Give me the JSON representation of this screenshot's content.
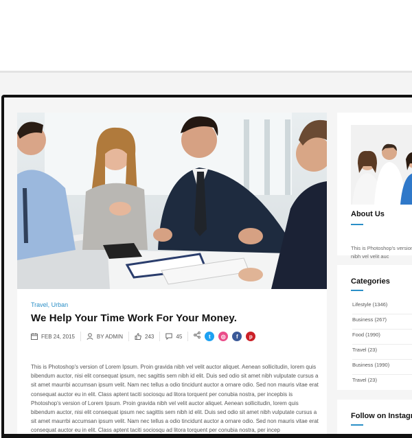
{
  "post": {
    "categories": "Travel, Urban",
    "title": "We Help Your Time Work For Your Money.",
    "meta": {
      "date": "FEB 24, 2015",
      "author": "BY ADMIN",
      "likes": "243",
      "comments": "45"
    },
    "social": [
      {
        "name": "twitter",
        "glyph": "t",
        "color": "#1da1f2"
      },
      {
        "name": "dribbble",
        "glyph": "◎",
        "color": "#ea4c89"
      },
      {
        "name": "facebook",
        "glyph": "f",
        "color": "#3b5998"
      },
      {
        "name": "pinterest",
        "glyph": "p",
        "color": "#cb2027"
      }
    ],
    "body": "This is Photoshop's version  of Lorem Ipsum. Proin gravida nibh vel velit auctor aliquet. Aenean sollicitudin, lorem quis bibendum auctor, nisi elit consequat ipsum, nec sagittis sem nibh id elit. Duis sed odio sit amet nibh vulputate cursus a sit amet maurrbi accumsan ipsum velit. Nam nec tellus a odio tincidunt auctor a ornare odio. Sed non mauris vitae erat consequat auctor eu in elit. Class aptent taciti sociosqu ad litora torquent per conubia nostra, per incepbis is Photoshop's version  of Lorem Ipsum. Proin gravida nibh vel velit auctor aliquet. Aenean sollicitudin, lorem quis bibendum auctor, nisi elit consequat ipsum nec sagittis sem nibh id elit. Duis sed odio sit amet nibh vulputate cursus a sit amet maurrbi accumsan ipsum velit. Nam nec tellus a odio tincidunt auctor a ornare odio. Sed non  mauris vitae erat consequat auctor eu in elit. Class aptent taciti sociosqu ad litora torquent per conubia nostra, per incep"
  },
  "sidebar": {
    "about": {
      "title": "About Us",
      "text": "This is Photoshop's version gravida nibh vel velit auc"
    },
    "categories": {
      "title": "Categories",
      "items": [
        {
          "label": "Lifestyle (1346)"
        },
        {
          "label": "Business (267)"
        },
        {
          "label": "Food (1990)"
        },
        {
          "label": "Travel (23)"
        },
        {
          "label": "Business (1990)"
        },
        {
          "label": "Travel (23)"
        }
      ]
    },
    "instagram": {
      "title": "Follow on Instagram"
    }
  },
  "colors": {
    "accent": "#2a8fc7",
    "title": "#111111",
    "frame": "#111111"
  }
}
